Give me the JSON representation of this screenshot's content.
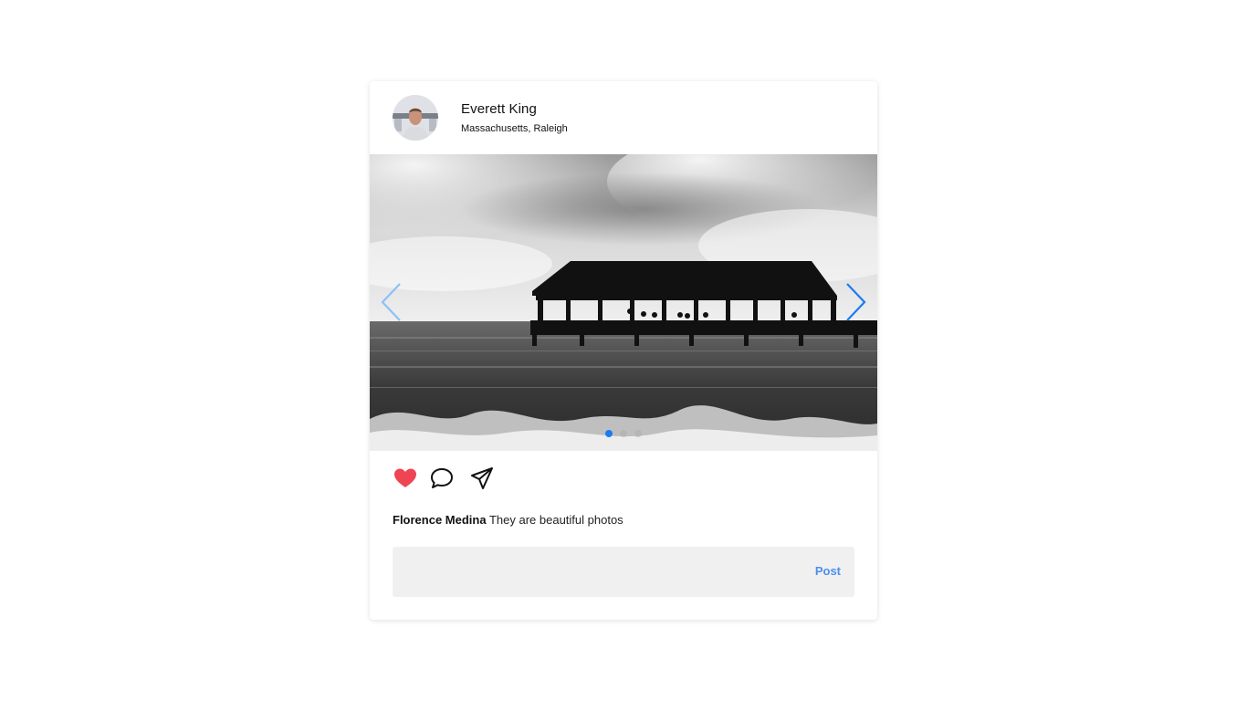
{
  "post": {
    "user": {
      "name": "Everett King",
      "location": "Massachusetts, Raleigh"
    },
    "carousel": {
      "slide_count": 3,
      "active_index": 0,
      "active_dot_color": "#1a7cf2",
      "inactive_dot_color": "#b0b0b0"
    },
    "actions": {
      "like_icon": "heart-icon",
      "like_color": "#ef4452",
      "comment_icon": "speech-bubble-icon",
      "share_icon": "paper-plane-icon"
    },
    "comment": {
      "author": "Florence Medina",
      "text": "They are beautiful photos"
    },
    "comment_form": {
      "placeholder": "",
      "value": "",
      "post_label": "Post",
      "post_color": "#4a8ff0"
    }
  }
}
